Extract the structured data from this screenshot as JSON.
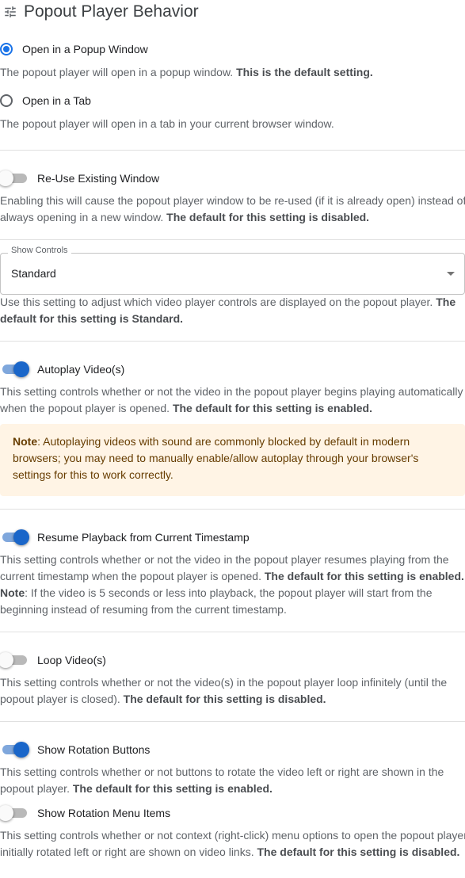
{
  "heading": {
    "title": "Popout Player Behavior",
    "icon": "tune-icon"
  },
  "open_mode": {
    "selected": "popup",
    "options": [
      {
        "label": "Open in a Popup Window",
        "desc": "The popout player will open in a popup window. ",
        "desc_bold": "This is the default setting."
      },
      {
        "label": "Open in a Tab",
        "desc": "The popout player will open in a tab in your current browser window."
      }
    ]
  },
  "reuse_window": {
    "label": "Re-Use Existing Window",
    "enabled": false,
    "desc": "Enabling this will cause the popout player window to be re-used (if it is already open) instead of always opening in a new window. ",
    "desc_bold": "The default for this setting is disabled."
  },
  "show_controls": {
    "label": "Show Controls",
    "value": "Standard",
    "desc": "Use this setting to adjust which video player controls are displayed on the popout player. ",
    "desc_bold": "The default for this setting is Standard."
  },
  "autoplay": {
    "label": "Autoplay Video(s)",
    "enabled": true,
    "desc": "This setting controls whether or not the video in the popout player begins playing automatically when the popout player is opened. ",
    "desc_bold": "The default for this setting is enabled.",
    "note_bold": "Note",
    "note_text": ": Autoplaying videos with sound are commonly blocked by default in modern browsers; you may need to manually enable/allow autoplay through your browser's settings for this to work correctly."
  },
  "resume_playback": {
    "label": "Resume Playback from Current Timestamp",
    "enabled": true,
    "desc": "This setting controls whether or not the video in the popout player resumes playing from the current timestamp when the popout player is opened. ",
    "desc_bold": "The default for this setting is enabled.",
    "note_bold": "Note",
    "note_text": ": If the video is 5 seconds or less into playback, the popout player will start from the beginning instead of resuming from the current timestamp."
  },
  "loop": {
    "label": "Loop Video(s)",
    "enabled": false,
    "desc": "This setting controls whether or not the video(s) in the popout player loop infinitely (until the popout player is closed). ",
    "desc_bold": "The default for this setting is disabled."
  },
  "rotation_buttons": {
    "label": "Show Rotation Buttons",
    "enabled": true,
    "desc": "This setting controls whether or not buttons to rotate the video left or right are shown in the popout player. ",
    "desc_bold": "The default for this setting is enabled."
  },
  "rotation_menu": {
    "label": "Show Rotation Menu Items",
    "enabled": false,
    "desc": "This setting controls whether or not context (right-click) menu options to open the popout player initially rotated left or right are shown on video links. ",
    "desc_bold": "The default for this setting is disabled."
  },
  "colors": {
    "accent": "#1a73e8",
    "toggle_on": "#1a66c9",
    "note_bg": "#fff4e5",
    "note_text": "#663c00"
  }
}
